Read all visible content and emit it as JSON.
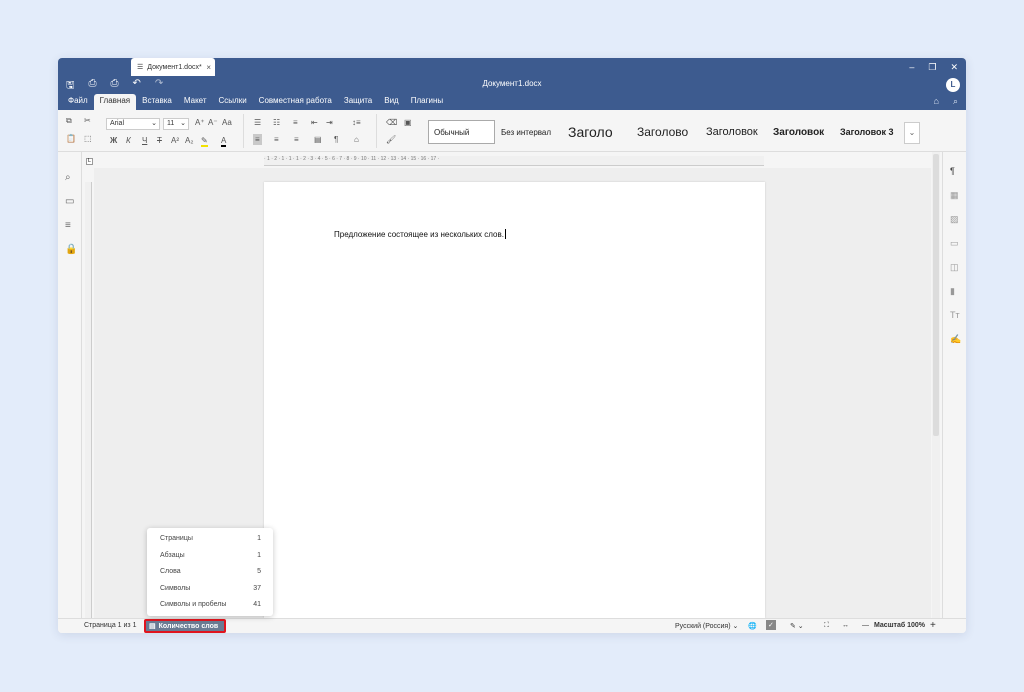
{
  "tab": {
    "title": "Документ1.docx*",
    "close": "×"
  },
  "window_controls": {
    "minimize": "–",
    "maximize": "❐",
    "close": "✕"
  },
  "titlebar": {
    "title": "Документ1.docx",
    "user_initial": "L"
  },
  "menu": {
    "items": [
      "Файл",
      "Главная",
      "Вставка",
      "Макет",
      "Ссылки",
      "Совместная работа",
      "Защита",
      "Вид",
      "Плагины"
    ],
    "active": "Главная"
  },
  "ribbon": {
    "font_name": "Arial",
    "font_size": "11",
    "styles": [
      "Обычный",
      "Без интервал",
      "Заголо",
      "Заголово",
      "Заголовок",
      "Заголовок",
      "Заголовок 3"
    ]
  },
  "ruler": {
    "marks": "· 1 · 2 · 1 · 1 · 1 · 2 · 3 · 4 · 5 · 6 · 7 · 8 · 9 · 10 · 11 · 12 · 13 · 14 · 15 · 16 · 17 ·"
  },
  "document": {
    "text": "Предложение состоящее из нескольких слов."
  },
  "status": {
    "page": "Страница 1 из 1",
    "word_count": "Количество слов",
    "language": "Русский (Россия)",
    "zoom": "Масштаб 100%"
  },
  "word_stats": [
    {
      "label": "Страницы",
      "value": "1"
    },
    {
      "label": "Абзацы",
      "value": "1"
    },
    {
      "label": "Слова",
      "value": "5"
    },
    {
      "label": "Символы",
      "value": "37"
    },
    {
      "label": "Символы и пробелы",
      "value": "41"
    }
  ]
}
